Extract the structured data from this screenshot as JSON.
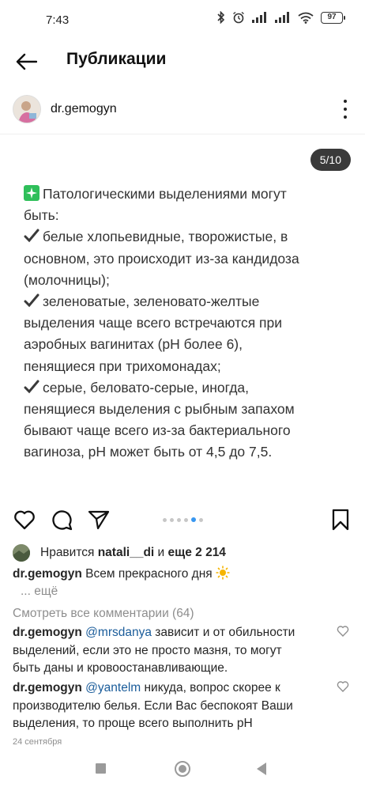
{
  "status_bar": {
    "time": "7:43",
    "battery": "97",
    "icons": [
      "bluetooth-icon",
      "alarm-icon",
      "signal-icon",
      "signal-icon",
      "wifi-icon",
      "battery-icon"
    ]
  },
  "header": {
    "title": "Публикации",
    "back_icon": "arrow-left-icon"
  },
  "post": {
    "username": "dr.gemogyn",
    "more_icon": "more-vertical-icon",
    "counter": "5/10",
    "slide_lines": {
      "l1": "Патологическими выделениями могут",
      "l2": "быть:",
      "l3": "белые хлопьевидные, творожистые, в",
      "l4": "основном, это происходит из-за кандидоза",
      "l5": "(молочницы);",
      "l6": "зеленоватые, зеленовато-желтые",
      "l7": "выделения чаще всего встречаются при",
      "l8": "аэробных вагинитах (pH более 6),",
      "l9": "пенящиеся при трихомонадах;",
      "l10": "серые, беловато-серые, иногда,",
      "l11": "пенящиеся выделения с рыбным запахом",
      "l12": "бывают чаще всего из-за бактериального",
      "l13": "вагиноза, pH может быть от 4,5 до 7,5."
    },
    "carousel": {
      "total_dots": 6,
      "active_dot": 5
    },
    "likes": {
      "prefix": "Нравится",
      "user": "natali__di",
      "middle": "и",
      "rest": "еще 2 214"
    },
    "caption": {
      "username": "dr.gemogyn",
      "text": "Всем прекрасного дня",
      "more": "... ещё"
    },
    "view_all_comments": "Смотреть все комментарии (64)",
    "comments": [
      {
        "username": "dr.gemogyn",
        "mention": "@mrsdanya",
        "line1": "зависит и от обильности",
        "line2": "выделений, если это не просто мазня, то могут",
        "line3": "быть даны и кровоостанавливающие."
      },
      {
        "username": "dr.gemogyn",
        "mention": "@yantelm",
        "line1": "никуда, вопрос скорее к",
        "line2": "производителю белья. Если Вас беспокоят Ваши",
        "line3": "выделения, то проще всего выполнить pH"
      }
    ],
    "timestamp": "24 сентября"
  },
  "colors": {
    "accent_blue": "#3897f0",
    "mention": "#1a5c9a",
    "muted": "#8e8e8e",
    "sparkle_green": "#2fbf5a"
  }
}
